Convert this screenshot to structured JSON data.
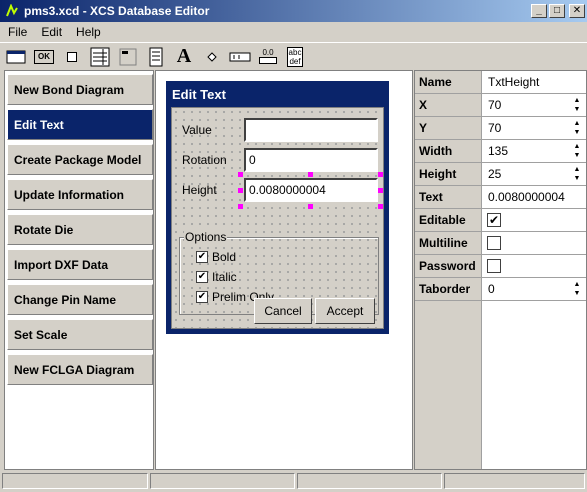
{
  "window": {
    "title": "pms3.xcd - XCS Database Editor",
    "minimize_label": "_",
    "maximize_label": "□",
    "close_label": "✕"
  },
  "menu": [
    "File",
    "Edit",
    "Help"
  ],
  "toolbar": {
    "icons": [
      "window-form-icon",
      "ok-button-icon",
      "square-icon",
      "list-table-icon",
      "abc-label-icon",
      "text-list-icon",
      "font-a-icon",
      "diamond-icon",
      "textbox-icon",
      "slider-icon",
      "abc-def-text-icon"
    ],
    "ok_icon_text": "OK",
    "font_icon_text": "A",
    "slider_icon_text": "0.0",
    "abc_def_text_1": "abc",
    "abc_def_text_2": "def"
  },
  "commands": [
    "New Bond Diagram",
    "Edit Text",
    "Create Package Model",
    "Update Information",
    "Rotate Die",
    "Import DXF Data",
    "Change Pin Name",
    "Set Scale",
    "New FCLGA Diagram"
  ],
  "active_command": "Edit Text",
  "dialog": {
    "title": "Edit Text",
    "value_label": "Value",
    "value": "",
    "rotation_label": "Rotation",
    "rotation": "0",
    "height_label": "Height",
    "height": "0.0080000004",
    "options_label": "Options",
    "options": [
      {
        "label": "Bold",
        "checked": true
      },
      {
        "label": "Italic",
        "checked": true
      },
      {
        "label": "Prelim Only",
        "checked": true
      }
    ],
    "cancel_label": "Cancel",
    "accept_label": "Accept"
  },
  "properties": [
    {
      "name": "Name",
      "value": "TxtHeight",
      "kind": "text"
    },
    {
      "name": "X",
      "value": "70",
      "kind": "spin"
    },
    {
      "name": "Y",
      "value": "70",
      "kind": "spin"
    },
    {
      "name": "Width",
      "value": "135",
      "kind": "spin"
    },
    {
      "name": "Height",
      "value": "25",
      "kind": "spin"
    },
    {
      "name": "Text",
      "value": "0.0080000004",
      "kind": "text"
    },
    {
      "name": "Editable",
      "value": true,
      "kind": "check"
    },
    {
      "name": "Multiline",
      "value": false,
      "kind": "check"
    },
    {
      "name": "Password",
      "value": false,
      "kind": "check"
    },
    {
      "name": "Taborder",
      "value": "0",
      "kind": "spin"
    }
  ],
  "colors": {
    "titlebar": "#0a246a",
    "selected_command": "#0a246a",
    "selection_handle": "#ff00ff",
    "face": "#d4d0c8"
  }
}
